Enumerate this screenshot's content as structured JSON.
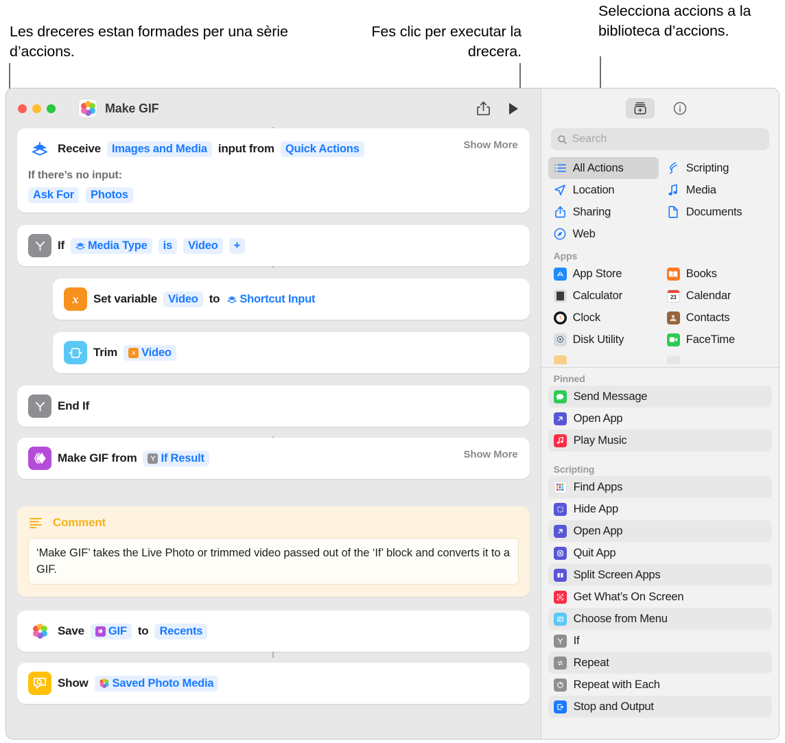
{
  "callouts": {
    "left": "Les dreceres estan formades per una sèrie d’accions.",
    "middle": "Fes clic per executar la drecera.",
    "right": "Selecciona accions a la biblioteca d’accions."
  },
  "window": {
    "title": "Make GIF",
    "app_icon": "photos-icon",
    "traffic_lights": [
      "close",
      "minimize",
      "zoom"
    ],
    "toolbar": {
      "share": "share-icon",
      "run": "play-icon"
    }
  },
  "flow": {
    "actions": [
      {
        "id": "receive",
        "icon": "receive-input-icon",
        "label": "Receive",
        "tokens": [
          "Images and Media"
        ],
        "mid": "input from",
        "tokens2": [
          "Quick Actions"
        ],
        "show_more": "Show More",
        "sub_label": "If there’s no input:",
        "sub_tokens": [
          "Ask For",
          "Photos"
        ]
      },
      {
        "id": "if",
        "icon": "if-icon",
        "label": "If",
        "var_token": "Media Type",
        "op": "is",
        "value_token": "Video",
        "add": "+"
      },
      {
        "id": "set-variable",
        "icon": "variable-icon",
        "label": "Set variable",
        "tokens": [
          "Video"
        ],
        "mid": "to",
        "tokens2": [
          "Shortcut Input"
        ]
      },
      {
        "id": "trim",
        "icon": "trim-icon",
        "label": "Trim",
        "tokens": [
          "Video"
        ]
      },
      {
        "id": "end-if",
        "icon": "if-icon",
        "label": "End If"
      },
      {
        "id": "make-gif",
        "icon": "make-gif-icon",
        "label": "Make GIF from",
        "tokens": [
          "If Result"
        ],
        "show_more": "Show More"
      }
    ],
    "comment": {
      "icon": "comment-icon",
      "title": "Comment",
      "body": "‘Make GIF’ takes the Live Photo or trimmed video passed out of the ‘If’ block and converts it to a GIF."
    },
    "actions_after": [
      {
        "id": "save",
        "icon": "photos-icon",
        "label": "Save",
        "tokens": [
          "GIF"
        ],
        "mid": "to",
        "tokens2": [
          "Recents"
        ]
      },
      {
        "id": "show",
        "icon": "quick-look-icon",
        "label": "Show",
        "tokens": [
          "Saved Photo Media"
        ]
      }
    ]
  },
  "library": {
    "toolbar": {
      "action_library": "action-library-icon",
      "info": "info-icon"
    },
    "search": {
      "placeholder": "Search",
      "value": "",
      "icon": "search-icon"
    },
    "categories": [
      {
        "label": "All Actions",
        "icon": "list-icon",
        "selected": true,
        "color": "#1a7aff"
      },
      {
        "label": "Scripting",
        "icon": "scripting-icon",
        "selected": false,
        "color": "#1a7aff"
      },
      {
        "label": "Location",
        "icon": "location-arrow-icon",
        "selected": false,
        "color": "#1a7aff"
      },
      {
        "label": "Media",
        "icon": "music-note-icon",
        "selected": false,
        "color": "#1a7aff"
      },
      {
        "label": "Sharing",
        "icon": "share-icon",
        "selected": false,
        "color": "#1a7aff"
      },
      {
        "label": "Documents",
        "icon": "document-icon",
        "selected": false,
        "color": "#1a7aff"
      },
      {
        "label": "Web",
        "icon": "safari-compass-icon",
        "selected": false,
        "color": "#1a7aff"
      }
    ],
    "apps_header": "Apps",
    "apps": [
      {
        "label": "App Store",
        "icon": "app-store-icon",
        "color": "#1f8bff"
      },
      {
        "label": "Books",
        "icon": "books-icon",
        "color": "#ff7a22"
      },
      {
        "label": "Calculator",
        "icon": "calculator-icon",
        "color": "#58585c"
      },
      {
        "label": "Calendar",
        "icon": "calendar-icon",
        "color": "#ffffff"
      },
      {
        "label": "Clock",
        "icon": "clock-icon",
        "color": "#16161a"
      },
      {
        "label": "Contacts",
        "icon": "contacts-icon",
        "color": "#96643d"
      },
      {
        "label": "Disk Utility",
        "icon": "disk-utility-icon",
        "color": "#d8dde4"
      },
      {
        "label": "FaceTime",
        "icon": "facetime-icon",
        "color": "#2ecc55"
      }
    ],
    "pinned_header": "Pinned",
    "pinned": [
      {
        "label": "Send Message",
        "icon": "messages-icon",
        "color": "#2ecc55",
        "alt": true
      },
      {
        "label": "Open App",
        "icon": "open-app-icon",
        "color": "#5856d6",
        "alt": false
      },
      {
        "label": "Play Music",
        "icon": "music-icon",
        "color": "#fa2d48",
        "alt": true
      }
    ],
    "scripting_header": "Scripting",
    "scripting": [
      {
        "label": "Find Apps",
        "icon": "find-apps-icon",
        "color": "#f7f7f7",
        "alt": true
      },
      {
        "label": "Hide App",
        "icon": "hide-app-icon",
        "color": "#5856d6",
        "alt": false
      },
      {
        "label": "Open App",
        "icon": "open-app-icon",
        "color": "#5856d6",
        "alt": true
      },
      {
        "label": "Quit App",
        "icon": "quit-app-icon",
        "color": "#5856d6",
        "alt": false
      },
      {
        "label": "Split Screen Apps",
        "icon": "split-screen-icon",
        "color": "#5856d6",
        "alt": true
      },
      {
        "label": "Get What’s On Screen",
        "icon": "screen-scan-icon",
        "color": "#fa2d48",
        "alt": false
      },
      {
        "label": "Choose from Menu",
        "icon": "menu-icon",
        "color": "#5ac8f5",
        "alt": true
      },
      {
        "label": "If",
        "icon": "if-icon",
        "color": "#8e8e93",
        "alt": false
      },
      {
        "label": "Repeat",
        "icon": "repeat-icon",
        "color": "#8e8e93",
        "alt": true
      },
      {
        "label": "Repeat with Each",
        "icon": "repeat-each-icon",
        "color": "#8e8e93",
        "alt": false
      },
      {
        "label": "Stop and Output",
        "icon": "stop-output-icon",
        "color": "#1a7aff",
        "alt": true
      }
    ]
  },
  "colors": {
    "accent_blue": "#1a7aff",
    "token_bg": "#e6f0ff",
    "orange": "#f7921e",
    "purple": "#b54cd9",
    "gray_icon": "#8e8e93",
    "yellow": "#ffc007",
    "cyan": "#5ac8f5",
    "comment_bg": "#fdf3e0"
  }
}
